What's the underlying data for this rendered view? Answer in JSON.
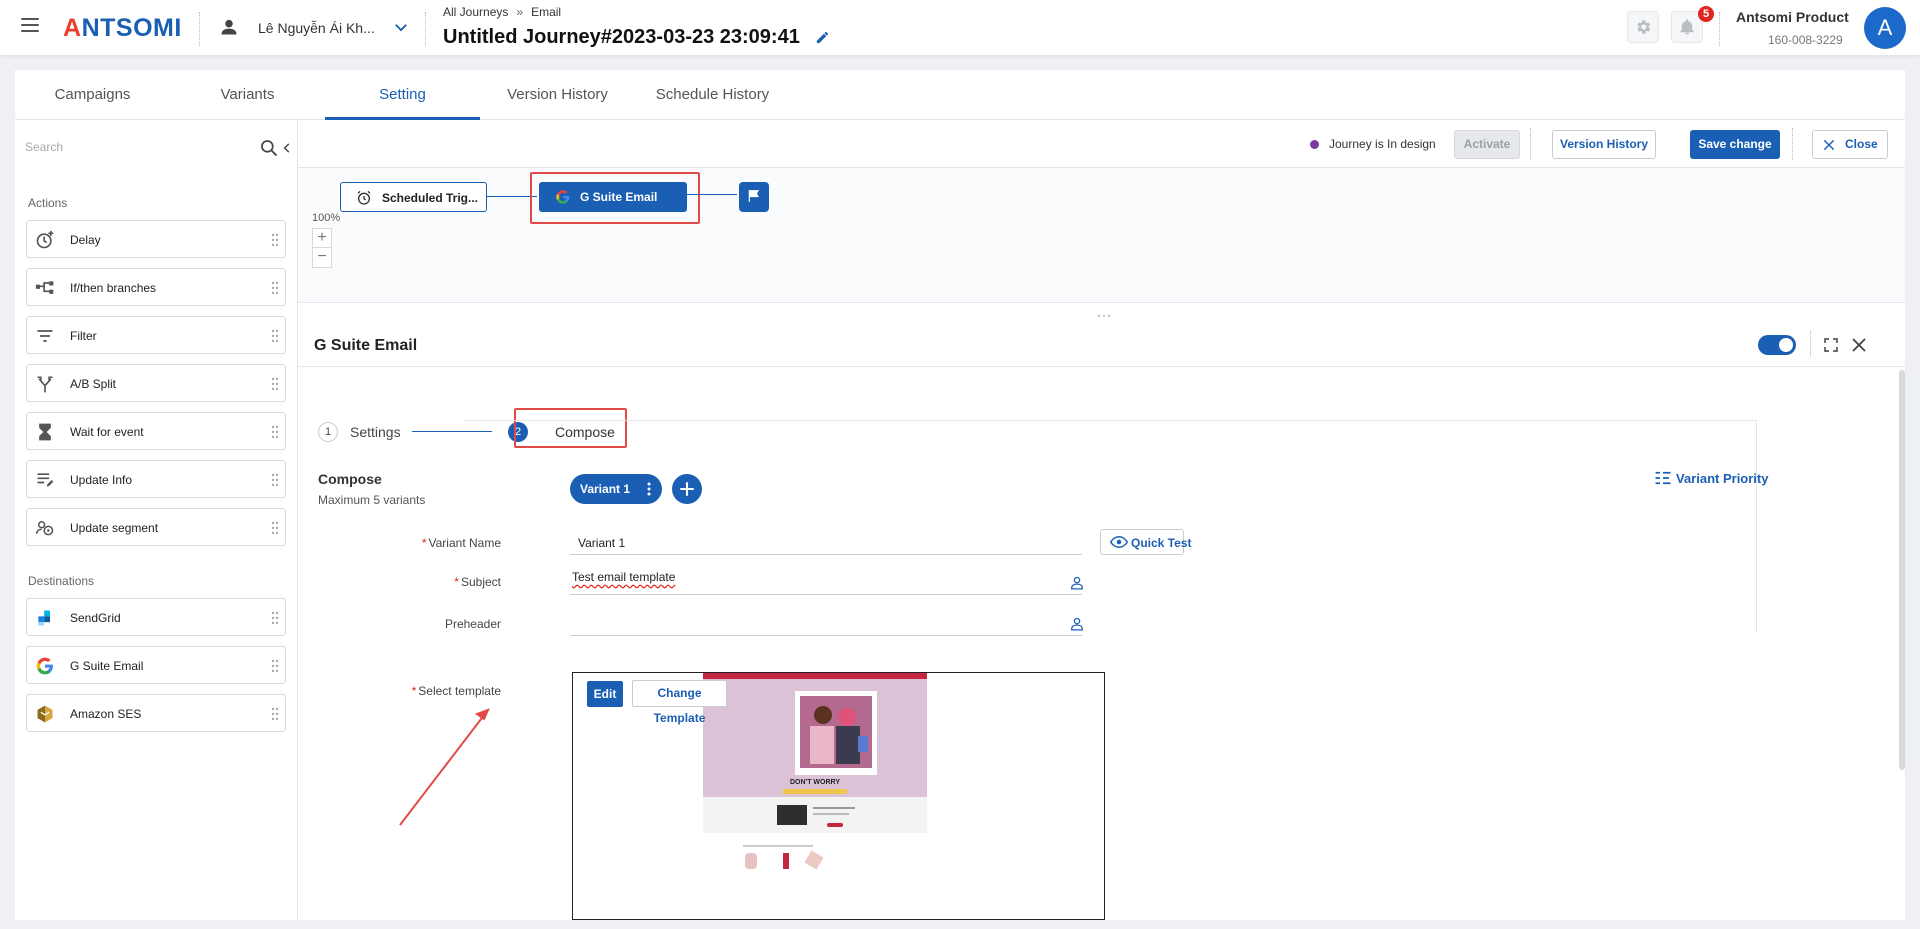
{
  "header": {
    "logo": "ANTSOMI",
    "user_name": "Lê Nguyễn Ái Kh...",
    "breadcrumb": [
      "All Journeys",
      "Email"
    ],
    "breadcrumb_sep": "»",
    "journey_title": "Untitled Journey#2023-03-23 23:09:41",
    "notification_count": "5",
    "account_name": "Antsomi Product",
    "account_id": "160-008-3229",
    "avatar_letter": "A"
  },
  "tabs": [
    {
      "label": "Campaigns",
      "active": false
    },
    {
      "label": "Variants",
      "active": false
    },
    {
      "label": "Setting",
      "active": true
    },
    {
      "label": "Version History",
      "active": false
    },
    {
      "label": "Schedule History",
      "active": false
    }
  ],
  "sidebar": {
    "search_placeholder": "Search",
    "actions_title": "Actions",
    "actions": [
      {
        "label": "Delay",
        "icon": "clock-plus-icon"
      },
      {
        "label": "If/then branches",
        "icon": "branch-icon"
      },
      {
        "label": "Filter",
        "icon": "filter-icon"
      },
      {
        "label": "A/B Split",
        "icon": "split-icon"
      },
      {
        "label": "Wait for event",
        "icon": "hourglass-icon"
      },
      {
        "label": "Update Info",
        "icon": "edit-list-icon"
      },
      {
        "label": "Update segment",
        "icon": "segment-icon"
      }
    ],
    "destinations_title": "Destinations",
    "destinations": [
      {
        "label": "SendGrid",
        "icon": "sendgrid-icon"
      },
      {
        "label": "G Suite Email",
        "icon": "google-icon"
      },
      {
        "label": "Amazon SES",
        "icon": "amazon-ses-icon"
      }
    ]
  },
  "toolbar": {
    "status_text": "Journey is In design",
    "status_color": "#7b3b9c",
    "activate_label": "Activate",
    "version_history_label": "Version History",
    "save_label": "Save change",
    "close_label": "Close"
  },
  "canvas": {
    "trigger_label": "Scheduled Trig...",
    "email_node_label": "G Suite Email",
    "zoom": "100%"
  },
  "panel": {
    "title": "G Suite Email",
    "steps": [
      {
        "num": "1",
        "label": "Settings",
        "active": false
      },
      {
        "num": "2",
        "label": "Compose",
        "active": true
      }
    ],
    "compose_title": "Compose",
    "max_variants": "Maximum 5 variants",
    "variant_chip": "Variant 1",
    "variant_priority": "Variant Priority",
    "fields": {
      "variant_name_label": "Variant Name",
      "variant_name_value": "Variant 1",
      "subject_label": "Subject",
      "subject_value": "Test email template",
      "preheader_label": "Preheader",
      "preheader_value": "",
      "template_label": "Select template"
    },
    "quick_test": "Quick Test",
    "edit_label": "Edit",
    "change_template_label": "Change Template",
    "template_preview": {
      "headline": "DON'T WORRY"
    }
  },
  "colors": {
    "brand": "#1b5fb5",
    "highlight": "#e34a4a",
    "template_bg": "#dcc2d6"
  }
}
